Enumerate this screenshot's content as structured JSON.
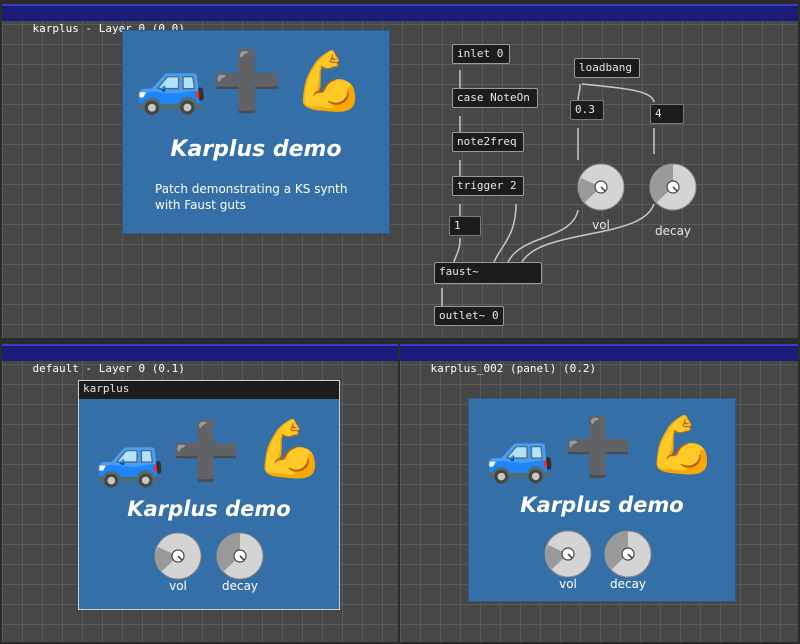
{
  "panes": {
    "top": {
      "title": "karplus - Layer 0 (0.0)"
    },
    "bottom_left": {
      "title": "default - Layer 0 (0.1)"
    },
    "bottom_right": {
      "title": "karplus_002 (panel) (0.2)"
    }
  },
  "demo_panel": {
    "emoji_car": "🚙",
    "emoji_plus": "➕",
    "emoji_muscle": "💪",
    "title": "Karplus demo",
    "description_line1": "Patch demonstrating a KS synth",
    "description_line2": "with Faust guts"
  },
  "objects": {
    "inlet": "inlet 0",
    "case": "case NoteOn",
    "note2freq": "note2freq",
    "trigger": "trigger 2",
    "number_1": "1",
    "loadbang": "loadbang",
    "num_vol": "0.3",
    "num_decay": "4",
    "faust": "faust~",
    "outlet": "outlet~ 0"
  },
  "knobs": {
    "vol": {
      "label": "vol",
      "value": 0.3
    },
    "decay": {
      "label": "decay",
      "value": 0.4
    }
  },
  "subpatch": {
    "title": "karplus"
  },
  "colors": {
    "panel_blue": "#356fa8",
    "titlebar_blue": "#1b1b7a",
    "canvas_gray": "#474747",
    "object_black": "#1c1c1c"
  }
}
